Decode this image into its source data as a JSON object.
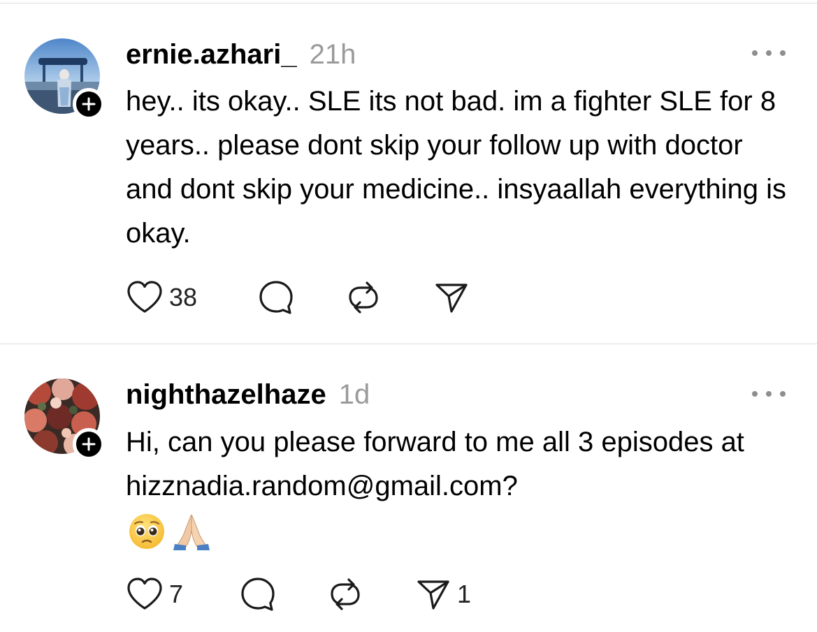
{
  "posts": [
    {
      "username": "ernie.azhari_",
      "time": "21h",
      "text": "hey.. its okay.. SLE its not bad. im a fighter SLE for 8 years.. please dont skip your follow up with doctor and dont skip your medicine.. insyaallah everything is okay.",
      "likes": "38",
      "shares": ""
    },
    {
      "username": "nighthazelhaze",
      "time": "1d",
      "text": "Hi, can you please forward to me all 3 episodes at hizznadia.random@gmail.com?",
      "emojis": [
        "pleading-face",
        "folded-hands"
      ],
      "likes": "7",
      "shares": "1"
    }
  ],
  "icons": {
    "like": "heart-icon",
    "reply": "comment-bubble-icon",
    "repost": "repost-arrows-icon",
    "share": "send-icon",
    "more": "more-dots-icon",
    "follow": "plus-icon"
  },
  "colors": {
    "text": "#000000",
    "meta": "#9a9a9a",
    "divider": "#dcdcdc",
    "icon": "#1a1a1a"
  }
}
